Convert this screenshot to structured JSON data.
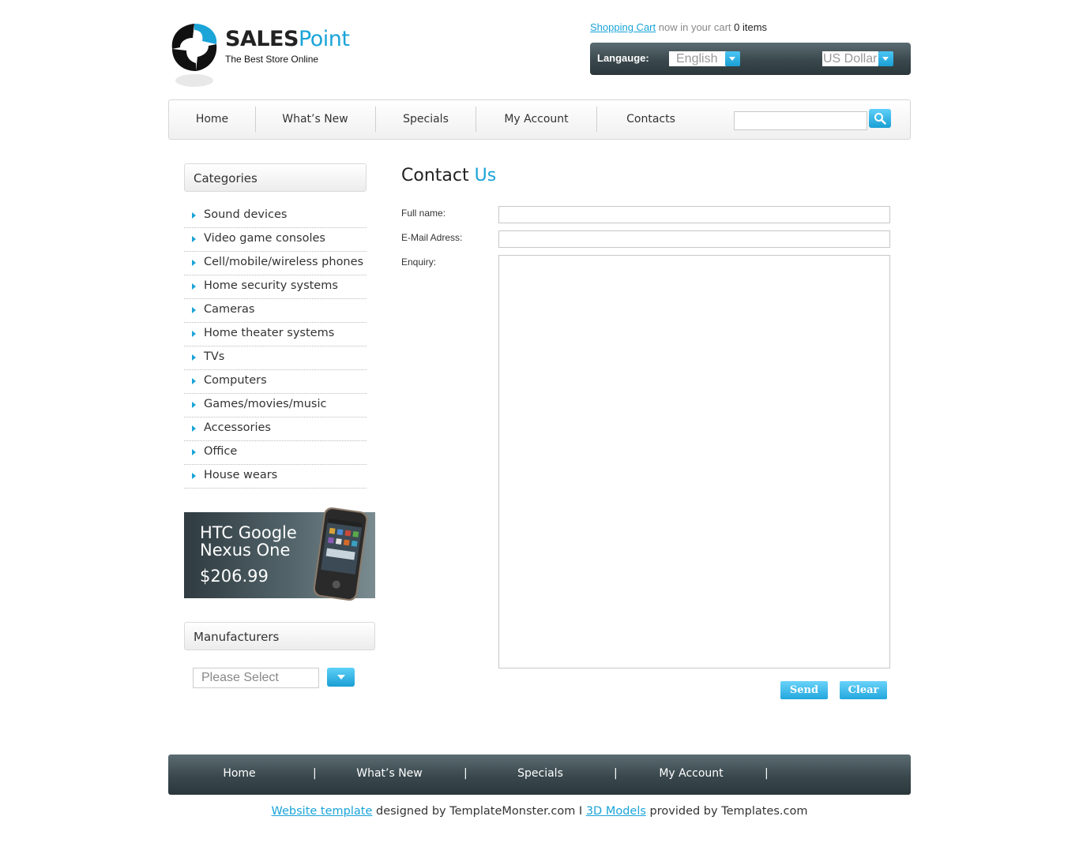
{
  "header": {
    "brand_bold": "SALES",
    "brand_light": "Point",
    "tagline": "The Best Store Online",
    "cart_link": "Shopping Cart",
    "cart_text": "now in your cart",
    "cart_count": "0",
    "cart_items": "items",
    "language_label": "Langauge:",
    "language_value": "English",
    "currency_value": "US Dollar"
  },
  "nav": {
    "items": [
      "Home",
      "What’s New",
      "Specials",
      "My Account",
      "Contacts"
    ],
    "search_placeholder": ""
  },
  "sidebar": {
    "categories_title": "Categories",
    "categories": [
      "Sound devices",
      "Video game consoles",
      "Cell/mobile/wireless phones",
      "Home security systems",
      "Cameras",
      "Home theater systems",
      "TVs",
      "Computers",
      "Games/movies/music",
      "Accessories",
      "Office",
      "House wears"
    ],
    "promo": {
      "name": "HTC Google Nexus One",
      "price": "$206.99"
    },
    "manufacturers_title": "Manufacturers",
    "manufacturers_select": "Please Select"
  },
  "main": {
    "title_plain": "Contact",
    "title_accent": "Us",
    "fields": {
      "full_name_label": "Full name:",
      "email_label": "E-Mail Adress:",
      "enquiry_label": "Enquiry:",
      "full_name_value": "",
      "email_value": "",
      "enquiry_value": ""
    },
    "send_label": "Send",
    "clear_label": "Clear"
  },
  "footer": {
    "items": [
      "Home",
      "What’s New",
      "Specials",
      "My Account"
    ],
    "separator": "|",
    "link1": "Website template",
    "text1": "designed by TemplateMonster.com I",
    "link2": "3D Models",
    "text2": "provided by Templates.com"
  },
  "colors": {
    "accent": "#1aa4d8",
    "dark_bar": "#3a484d"
  }
}
